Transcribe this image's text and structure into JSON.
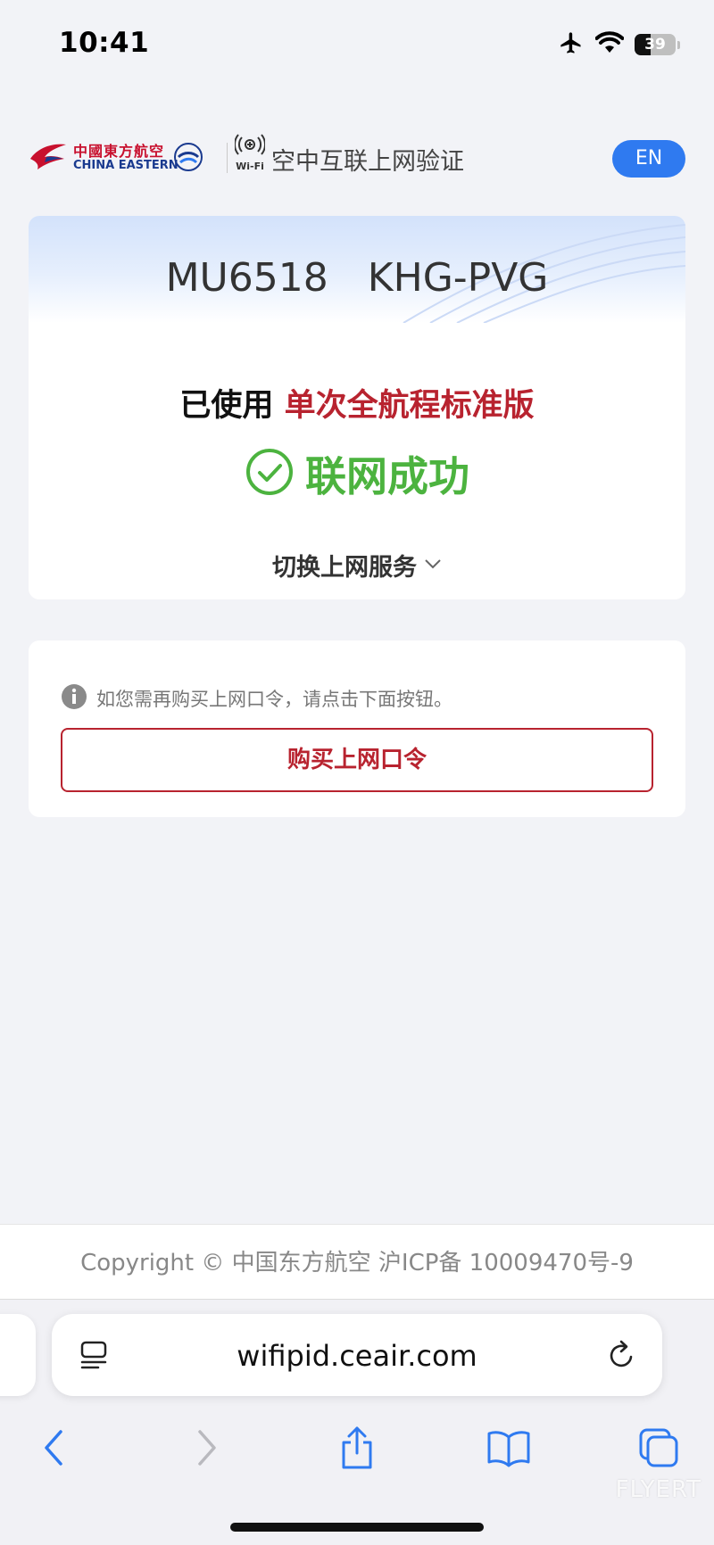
{
  "status_bar": {
    "time": "10:41",
    "battery": "39",
    "battery_level": 0.39
  },
  "header": {
    "airline_cn": "中國東方航空",
    "airline_en": "CHINA EASTERN",
    "wifi_label": "Wi-Fi",
    "title": "空中互联上网验证",
    "lang_button": "EN"
  },
  "flight": {
    "number": "MU6518",
    "route": "KHG-PVG"
  },
  "service": {
    "prefix": "已使用",
    "plan": "单次全航程标准版",
    "status": "联网成功",
    "switch_label": "切换上网服务"
  },
  "purchase": {
    "info": "如您需再购买上网口令，请点击下面按钮。",
    "button": "购买上网口令"
  },
  "footer": {
    "copyright": "Copyright © 中国东方航空 沪ICP备 10009470号-9"
  },
  "browser": {
    "url": "wifipid.ceair.com"
  },
  "watermark": "FLYERT",
  "colors": {
    "accent_blue": "#2f7af0",
    "brand_red": "#b8232f",
    "success_green": "#4cb33f"
  }
}
